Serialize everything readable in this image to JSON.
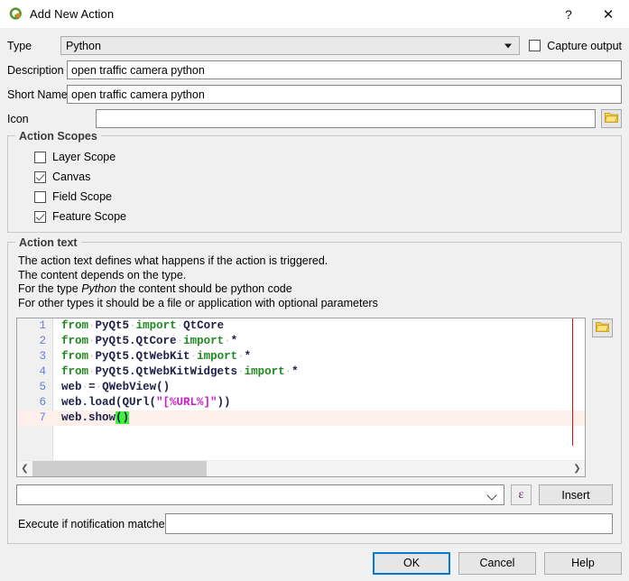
{
  "window": {
    "title": "Add New Action",
    "app_icon": "qgis-logo-icon",
    "help_button": "?",
    "close_button": "✕"
  },
  "form": {
    "type_label": "Type",
    "type_value": "Python",
    "type_icon": "chevron-down-icon",
    "capture_output_label": "Capture output",
    "capture_output_checked": false,
    "description_label": "Description",
    "description_value": "open traffic camera python",
    "short_name_label": "Short Name",
    "short_name_value": "open traffic camera python",
    "icon_label": "Icon",
    "icon_value": "",
    "icon_browse": "folder-open-icon"
  },
  "action_scopes": {
    "title": "Action Scopes",
    "items": [
      {
        "label": "Layer Scope",
        "checked": false
      },
      {
        "label": "Canvas",
        "checked": true
      },
      {
        "label": "Field Scope",
        "checked": false
      },
      {
        "label": "Feature Scope",
        "checked": true
      }
    ]
  },
  "action_text": {
    "title": "Action text",
    "help_line_1": "The action text defines what happens if the action is triggered.",
    "help_line_2": "The content depends on the type.",
    "help_line_3_pre": "For the type ",
    "help_line_3_em": "Python",
    "help_line_3_post": " the content should be python code",
    "help_line_4": "For other types it should be a file or application with optional parameters",
    "browse_icon": "folder-open-icon",
    "code": [
      {
        "num": "1",
        "text": "from PyQt5 import QtCore"
      },
      {
        "num": "2",
        "text": "from PyQt5.QtCore import *"
      },
      {
        "num": "3",
        "text": "from PyQt5.QtWebKit import *"
      },
      {
        "num": "4",
        "text": "from PyQt5.QtWebKitWidgets import *"
      },
      {
        "num": "5",
        "text": "web = QWebView()"
      },
      {
        "num": "6",
        "text": "web.load(QUrl(\"[%URL%]\"))"
      },
      {
        "num": "7",
        "text": "web.show()"
      }
    ],
    "scroll_left_icon": "chevron-left-icon",
    "scroll_right_icon": "chevron-right-icon",
    "expression_value": "",
    "expression_chevron": "chevron-down-icon",
    "epsilon_button": "ε",
    "insert_button": "Insert",
    "notification_label": "Execute if notification matches",
    "notification_value": ""
  },
  "footer": {
    "ok": "OK",
    "cancel": "Cancel",
    "help": "Help"
  },
  "colors": {
    "accent": "#0a7ad1",
    "keyword": "#1f8a1f",
    "string": "#c520c5",
    "identifier": "#20204a",
    "line_number": "#6a7ddb",
    "margin_line": "#d81010",
    "current_line": "#fdf0ea",
    "brace_match": "#3ff23f"
  }
}
